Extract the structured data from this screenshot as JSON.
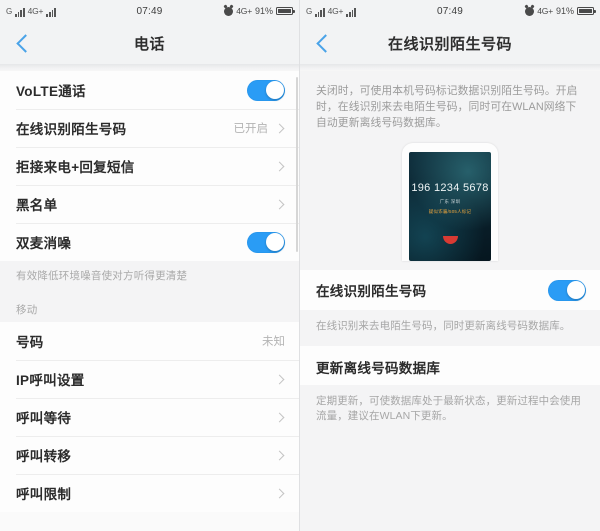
{
  "status_bar": {
    "carrier_g": "G",
    "network_label": "4G+",
    "time": "07:49",
    "net_right_label": "4G+",
    "battery_percent": "91%",
    "alarm_icon": "alarm-clock-icon",
    "signal_icon": "signal-bars-icon",
    "battery_icon": "battery-icon"
  },
  "left_screen": {
    "nav": {
      "back_icon": "chevron-left-icon",
      "title": "电话"
    },
    "groups": [
      {
        "rows": [
          {
            "label": "VoLTE通话",
            "control": "toggle",
            "toggle_on": true
          },
          {
            "label": "在线识别陌生号码",
            "value": "已开启",
            "control": "chevron"
          },
          {
            "label": "拒接来电+回复短信",
            "value": "",
            "control": "chevron"
          },
          {
            "label": "黑名单",
            "value": "",
            "control": "chevron"
          },
          {
            "label": "双麦消噪",
            "control": "toggle",
            "toggle_on": true
          }
        ],
        "hint": "有效降低环境噪音使对方听得更清楚"
      },
      {
        "section_title": "移动",
        "rows": [
          {
            "label": "号码",
            "value": "未知",
            "control": "none"
          },
          {
            "label": "IP呼叫设置",
            "value": "",
            "control": "chevron"
          },
          {
            "label": "呼叫等待",
            "value": "",
            "control": "chevron"
          },
          {
            "label": "呼叫转移",
            "value": "",
            "control": "chevron"
          },
          {
            "label": "呼叫限制",
            "value": "",
            "control": "chevron"
          }
        ]
      }
    ]
  },
  "right_screen": {
    "nav": {
      "back_icon": "chevron-left-icon",
      "title": "在线识别陌生号码"
    },
    "description": "关闭时，可使用本机号码标记数据识别陌生号码。开启时，在线识别来去电陌生号码，同时可在WLAN网络下自动更新离线号码数据库。",
    "illustration": {
      "phone_number": "196 1234 5678",
      "region": "广东 深圳",
      "mark_tag": "疑似诈骗/505人标记",
      "hangup_icon": "hangup-call-icon"
    },
    "setting_row": {
      "label": "在线识别陌生号码",
      "toggle_on": true,
      "desc": "在线识别来去电陌生号码，同时更新离线号码数据库。"
    },
    "update_section": {
      "title": "更新离线号码数据库",
      "desc": "定期更新，可使数据库处于最新状态，更新过程中会使用流量，建议在WLAN下更新。"
    }
  },
  "colors": {
    "accent_blue": "#2a9cf5",
    "back_arrow_blue": "#4aa3e8",
    "tag_orange": "#e8a33c",
    "hangup_red": "#d83a33"
  }
}
